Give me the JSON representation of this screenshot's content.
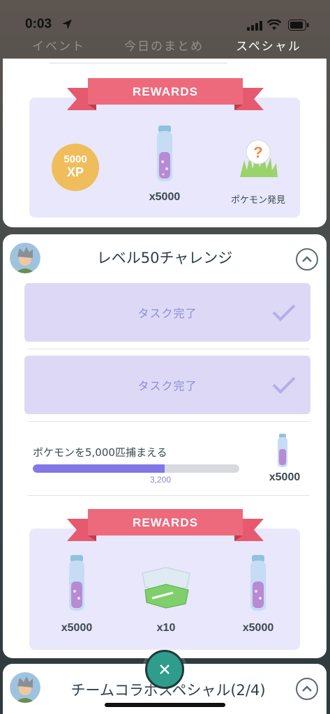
{
  "status_bar": {
    "time": "0:03"
  },
  "tabs": {
    "events": "イベント",
    "summary": "今日のまとめ",
    "special": "スペシャル"
  },
  "card1": {
    "ribbon": "REWARDS",
    "xp_amount": "5000",
    "xp_unit": "XP",
    "item_quantity": "x5000",
    "encounter_label": "ポケモン発見"
  },
  "challenge": {
    "title": "レベル50チャレンジ",
    "task1": "タスク完了",
    "task2": "タスク完了",
    "task3_text": "ポケモンを5,000匹捕まえる",
    "task3_progress_value": "3,200",
    "task3_progress_fraction": 0.64,
    "task3_reward_quantity": "x5000",
    "ribbon": "REWARDS",
    "rewards": [
      "x5000",
      "x10",
      "x5000"
    ]
  },
  "next_challenge": {
    "title": "チームコラボスペシャル(2/4)"
  },
  "colors": {
    "ribbon": "#ec6a7c",
    "panel": "#e8e7fb",
    "progress": "#8277e6",
    "close_button": "#2f9c8c"
  }
}
